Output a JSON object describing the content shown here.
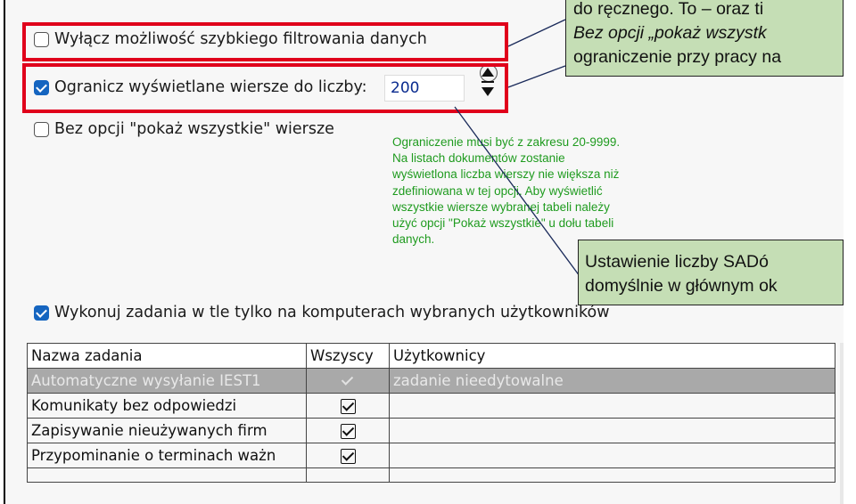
{
  "options": {
    "disable_quick_filter": {
      "label": "Wyłącz możliwość szybkiego filtrowania danych",
      "checked": false
    },
    "limit_rows": {
      "label": "Ogranicz wyświetlane wiersze do liczby:",
      "checked": true,
      "value": "200"
    },
    "no_show_all": {
      "label": "Bez opcji \"pokaż wszystkie\" wiersze",
      "checked": false
    },
    "background_tasks": {
      "label": "Wykonuj zadania w tle tylko na komputerach wybranych użytkowników",
      "checked": true
    }
  },
  "info_text": "Ograniczenie musi być z zakresu 20-9999.\nNa listach dokumentów zostanie\nwyświetlona liczba wierszy nie większa niż\nzdefiniowana w tej opcji. Aby wyświetlić\nwszystkie wiersze wybranej tabeli należy\nużyć opcji \"Pokaż wszystkie\" u dołu tabeli\ndanych.",
  "callout_top": {
    "line1": "do ręcznego. To – oraz ti",
    "line2": "Bez opcji „pokaż wszystk",
    "line3": "ograniczenie przy pracy na"
  },
  "callout_bottom": {
    "line1": "Ustawienie   liczby   SADó",
    "line2": "domyślnie w głównym ok"
  },
  "table": {
    "headers": [
      "Nazwa zadania",
      "Wszyscy",
      "Użytkownicy"
    ],
    "rows": [
      {
        "name": "Automatyczne wysyłanie IEST1",
        "all": true,
        "users": "zadanie nieedytowalne",
        "disabled": true
      },
      {
        "name": "Komunikaty bez odpowiedzi",
        "all": true,
        "users": "",
        "disabled": false
      },
      {
        "name": "Zapisywanie nieużywanych firm",
        "all": true,
        "users": "",
        "disabled": false
      },
      {
        "name": "Przypominanie o terminach ważn",
        "all": true,
        "users": "",
        "disabled": false
      }
    ]
  },
  "colors": {
    "highlight": "#e0001b",
    "callout_bg": "#c5deb5",
    "info_text": "#1f9b1f",
    "checkbox_accent": "#1565c0"
  }
}
